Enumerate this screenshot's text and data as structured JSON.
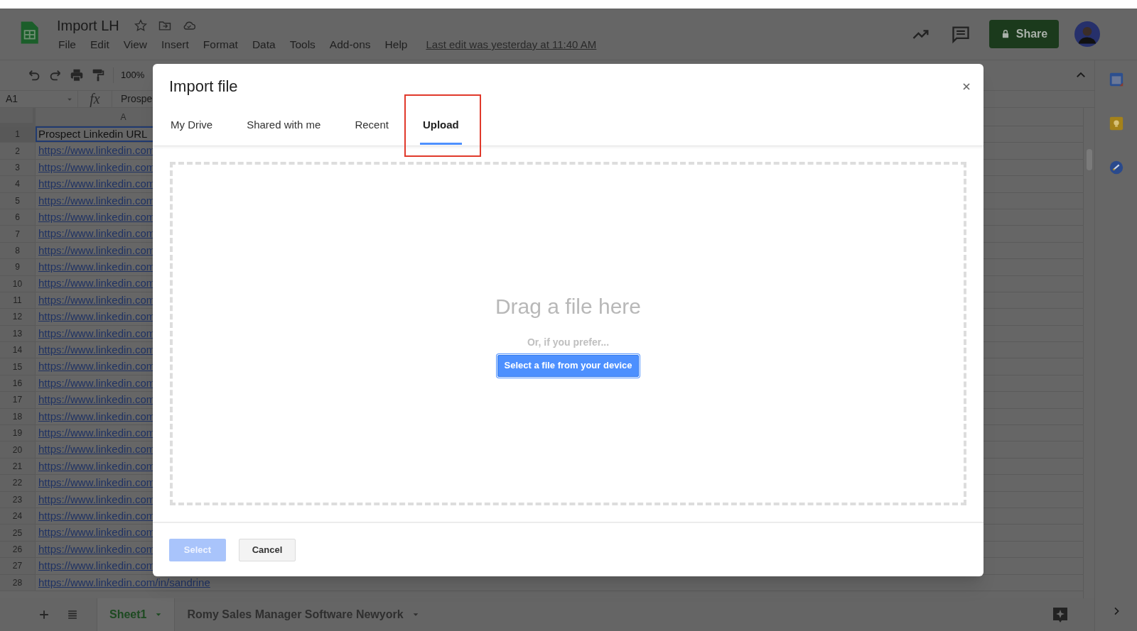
{
  "app": {
    "title": "Import LH",
    "menu": [
      "File",
      "Edit",
      "View",
      "Insert",
      "Format",
      "Data",
      "Tools",
      "Add-ons",
      "Help"
    ],
    "last_edit": "Last edit was yesterday at 11:40 AM",
    "share_button": "Share"
  },
  "toolbar": {
    "zoom": "100%"
  },
  "formula_bar": {
    "cell_ref": "A1",
    "function_label": "fx",
    "content": "Prospe"
  },
  "sheet": {
    "column_header": "A",
    "rows": [
      {
        "number": "1",
        "value": "Prospect Linkedin URL",
        "kind": "text",
        "selected": true
      },
      {
        "number": "2",
        "value": "https://www.linkedin.com",
        "kind": "link",
        "selected": false
      },
      {
        "number": "3",
        "value": "https://www.linkedin.com",
        "kind": "link",
        "selected": false
      },
      {
        "number": "4",
        "value": "https://www.linkedin.com",
        "kind": "link",
        "selected": false
      },
      {
        "number": "5",
        "value": "https://www.linkedin.com",
        "kind": "link",
        "selected": false
      },
      {
        "number": "6",
        "value": "https://www.linkedin.com",
        "kind": "link",
        "selected": false
      },
      {
        "number": "7",
        "value": "https://www.linkedin.com",
        "kind": "link",
        "selected": false
      },
      {
        "number": "8",
        "value": "https://www.linkedin.com",
        "kind": "link",
        "selected": false
      },
      {
        "number": "9",
        "value": "https://www.linkedin.com",
        "kind": "link",
        "selected": false
      },
      {
        "number": "10",
        "value": "https://www.linkedin.com",
        "kind": "link",
        "selected": false
      },
      {
        "number": "11",
        "value": "https://www.linkedin.com",
        "kind": "link",
        "selected": false
      },
      {
        "number": "12",
        "value": "https://www.linkedin.com",
        "kind": "link",
        "selected": false
      },
      {
        "number": "13",
        "value": "https://www.linkedin.com",
        "kind": "link",
        "selected": false
      },
      {
        "number": "14",
        "value": "https://www.linkedin.com",
        "kind": "link",
        "selected": false
      },
      {
        "number": "15",
        "value": "https://www.linkedin.com",
        "kind": "link",
        "selected": false
      },
      {
        "number": "16",
        "value": "https://www.linkedin.com",
        "kind": "link",
        "selected": false
      },
      {
        "number": "17",
        "value": "https://www.linkedin.com",
        "kind": "link",
        "selected": false
      },
      {
        "number": "18",
        "value": "https://www.linkedin.com",
        "kind": "link",
        "selected": false
      },
      {
        "number": "19",
        "value": "https://www.linkedin.com",
        "kind": "link",
        "selected": false
      },
      {
        "number": "20",
        "value": "https://www.linkedin.com",
        "kind": "link",
        "selected": false
      },
      {
        "number": "21",
        "value": "https://www.linkedin.com",
        "kind": "link",
        "selected": false
      },
      {
        "number": "22",
        "value": "https://www.linkedin.com",
        "kind": "link",
        "selected": false
      },
      {
        "number": "23",
        "value": "https://www.linkedin.com",
        "kind": "link",
        "selected": false
      },
      {
        "number": "24",
        "value": "https://www.linkedin.com",
        "kind": "link",
        "selected": false
      },
      {
        "number": "25",
        "value": "https://www.linkedin.com",
        "kind": "link",
        "selected": false
      },
      {
        "number": "26",
        "value": "https://www.linkedin.com",
        "kind": "link",
        "selected": false
      },
      {
        "number": "27",
        "value": "https://www.linkedin.com",
        "kind": "link",
        "selected": false
      },
      {
        "number": "28",
        "value": "https://www.linkedin.com/in/sandrine",
        "kind": "link",
        "selected": false
      }
    ]
  },
  "sheet_tabs": [
    {
      "label": "Sheet1",
      "selected": true
    },
    {
      "label": "Romy Sales Manager Software Newyork",
      "selected": false
    }
  ],
  "dialog": {
    "title": "Import file",
    "tabs": [
      {
        "label": "My Drive",
        "selected": false,
        "highlighted": false
      },
      {
        "label": "Shared with me",
        "selected": false,
        "highlighted": false
      },
      {
        "label": "Recent",
        "selected": false,
        "highlighted": false
      },
      {
        "label": "Upload",
        "selected": true,
        "highlighted": true
      }
    ],
    "drop_zone": {
      "heading": "Drag a file here",
      "hint": "Or, if you prefer...",
      "button": "Select a file from your device"
    },
    "buttons": [
      {
        "label": "Select",
        "kind": "primary",
        "disabled": true
      },
      {
        "label": "Cancel",
        "kind": "secondary",
        "disabled": false
      }
    ]
  }
}
